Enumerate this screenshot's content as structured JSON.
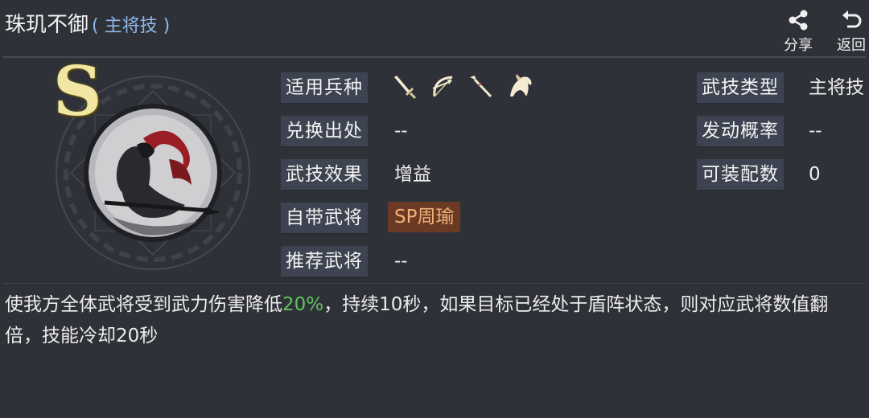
{
  "header": {
    "title": "珠玑不御",
    "category": "( 主将技 )",
    "share_label": "分享",
    "back_label": "返回"
  },
  "skill": {
    "grade": "S"
  },
  "details": {
    "unit_types_label": "适用兵种",
    "unit_types": [
      "sword-icon",
      "bow-icon",
      "spear-icon",
      "horse-icon"
    ],
    "skill_type_label": "武技类型",
    "skill_type_value": "主将技",
    "source_label": "兑换出处",
    "source_value": "--",
    "trigger_rate_label": "发动概率",
    "trigger_rate_value": "--",
    "effect_label": "武技效果",
    "effect_value": "增益",
    "equip_count_label": "可装配数",
    "equip_count_value": "0",
    "native_general_label": "自带武将",
    "native_general_value": "SP周瑜",
    "recommended_label": "推荐武将",
    "recommended_value": "--"
  },
  "description": {
    "part1": "使我方全体武将受到武力伤害降低",
    "highlight": "20%",
    "part2": "，持续10秒，如果目标已经处于盾阵状态，则对应武将数值翻倍，技能冷却20秒"
  },
  "colors": {
    "background": "#2f3138",
    "label_bg": "#3d4350",
    "category": "#8fb8e8",
    "highlight": "#5fc35a",
    "tag_bg": "#6b3a24",
    "tag_text": "#f0b07a",
    "grade": "#f2e7a2"
  }
}
